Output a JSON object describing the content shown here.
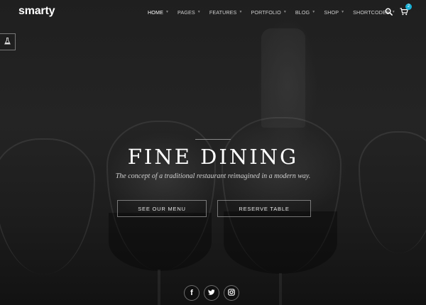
{
  "brand": {
    "logo_text": "smarty"
  },
  "nav": {
    "items": [
      {
        "label": "HOME",
        "active": true,
        "dropdown": true
      },
      {
        "label": "PAGES",
        "active": false,
        "dropdown": true
      },
      {
        "label": "FEATURES",
        "active": false,
        "dropdown": true
      },
      {
        "label": "PORTFOLIO",
        "active": false,
        "dropdown": true
      },
      {
        "label": "BLOG",
        "active": false,
        "dropdown": true
      },
      {
        "label": "SHOP",
        "active": false,
        "dropdown": true
      },
      {
        "label": "SHORTCODES",
        "active": false,
        "dropdown": true
      }
    ],
    "search_icon": "search-icon",
    "cart_icon": "cart-icon",
    "cart_count": "2"
  },
  "side_panel": {
    "icon": "flask-icon"
  },
  "hero": {
    "title": "FINE DINING",
    "subtitle": "The concept of a traditional restaurant reimagined in a modern way.",
    "buttons": {
      "menu_label": "SEE OUR MENU",
      "reserve_label": "RESERVE TABLE"
    }
  },
  "social": {
    "facebook_icon": "f",
    "twitter_icon": "twitter-icon",
    "instagram_icon": "instagram-icon"
  },
  "colors": {
    "accent": "#1ab1d6",
    "background": "#1f1f1f",
    "text": "#ffffff"
  }
}
